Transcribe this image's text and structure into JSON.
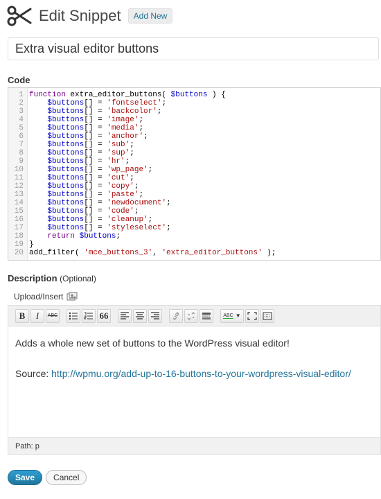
{
  "header": {
    "title": "Edit Snippet",
    "add_new_label": "Add New"
  },
  "snippet": {
    "title_value": "Extra visual editor buttons"
  },
  "code_section": {
    "label": "Code",
    "lines": [
      {
        "n": "1",
        "t": "function extra_editor_buttons( $buttons ) {"
      },
      {
        "n": "2",
        "t": "    $buttons[] = 'fontselect';"
      },
      {
        "n": "3",
        "t": "    $buttons[] = 'backcolor';"
      },
      {
        "n": "4",
        "t": "    $buttons[] = 'image';"
      },
      {
        "n": "5",
        "t": "    $buttons[] = 'media';"
      },
      {
        "n": "6",
        "t": "    $buttons[] = 'anchor';"
      },
      {
        "n": "7",
        "t": "    $buttons[] = 'sub';"
      },
      {
        "n": "8",
        "t": "    $buttons[] = 'sup';"
      },
      {
        "n": "9",
        "t": "    $buttons[] = 'hr';"
      },
      {
        "n": "10",
        "t": "    $buttons[] = 'wp_page';"
      },
      {
        "n": "11",
        "t": "    $buttons[] = 'cut';"
      },
      {
        "n": "12",
        "t": "    $buttons[] = 'copy';"
      },
      {
        "n": "13",
        "t": "    $buttons[] = 'paste';"
      },
      {
        "n": "14",
        "t": "    $buttons[] = 'newdocument';"
      },
      {
        "n": "15",
        "t": "    $buttons[] = 'code';"
      },
      {
        "n": "16",
        "t": "    $buttons[] = 'cleanup';"
      },
      {
        "n": "17",
        "t": "    $buttons[] = 'styleselect';"
      },
      {
        "n": "18",
        "t": "    return $buttons;"
      },
      {
        "n": "19",
        "t": "}"
      },
      {
        "n": "20",
        "t": "add_filter( 'mce_buttons_3', 'extra_editor_buttons' );"
      }
    ]
  },
  "description_section": {
    "label": "Description",
    "optional_label": "(Optional)",
    "upload_insert_label": "Upload/Insert",
    "toolbar": {
      "bold": "B",
      "italic": "I",
      "strike": "ABC",
      "quote": "66",
      "spellcheck": "ABC"
    },
    "content": {
      "paragraph": "Adds a whole new set of buttons to the WordPress visual editor!",
      "source_label": "Source:",
      "source_link": "http://wpmu.org/add-up-to-16-buttons-to-your-wordpress-visual-editor/"
    },
    "path": "Path: p"
  },
  "actions": {
    "save_label": "Save",
    "cancel_label": "Cancel"
  },
  "colors": {
    "link": "#21759b",
    "save_button": "#21759b",
    "keyword": "#770088",
    "variable": "#0000cc",
    "string": "#aa1111"
  }
}
